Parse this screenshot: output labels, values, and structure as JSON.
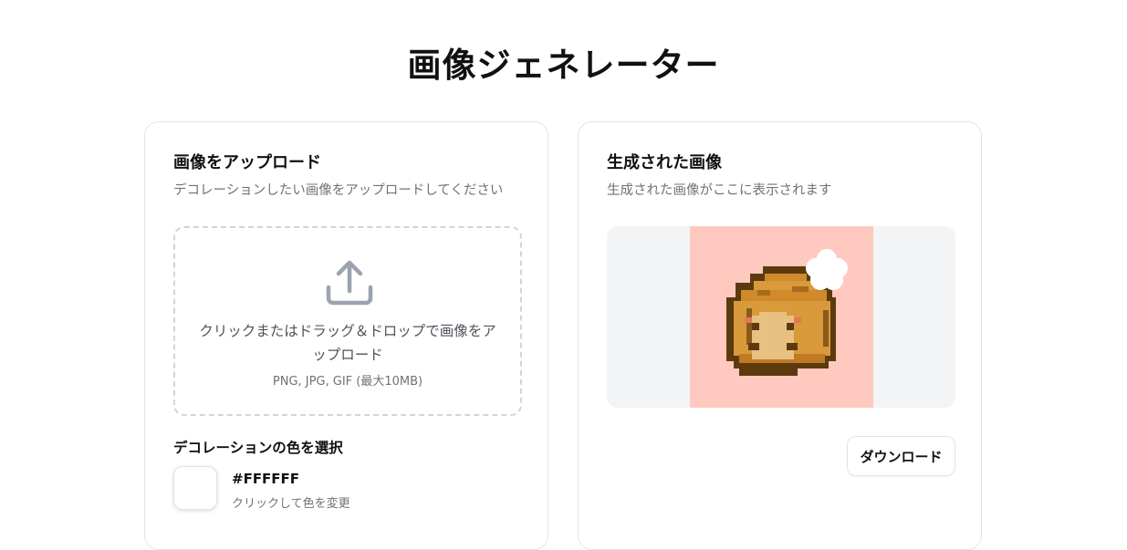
{
  "page": {
    "title": "画像ジェネレーター"
  },
  "upload_card": {
    "title": "画像をアップロード",
    "description": "デコレーションしたい画像をアップロードしてください",
    "dropzone": {
      "icon": "upload-icon",
      "text": "クリックまたはドラッグ＆ドロップで画像をアップロード",
      "hint": "PNG, JPG, GIF (最大10MB)"
    },
    "color_section": {
      "heading": "デコレーションの色を選択",
      "selected_color": "#FFFFFF",
      "hex_label": "#FFFFFF",
      "hint": "クリックして色を変更"
    }
  },
  "result_card": {
    "title": "生成された画像",
    "description": "生成された画像がここに表示されます",
    "preview_background": "#ffc9bf",
    "download_label": "ダウンロード"
  },
  "colors": {
    "accent_text": "#111111",
    "muted_text": "#71717a",
    "border": "#e4e4e7",
    "preview_bg": "#f3f4f6"
  }
}
